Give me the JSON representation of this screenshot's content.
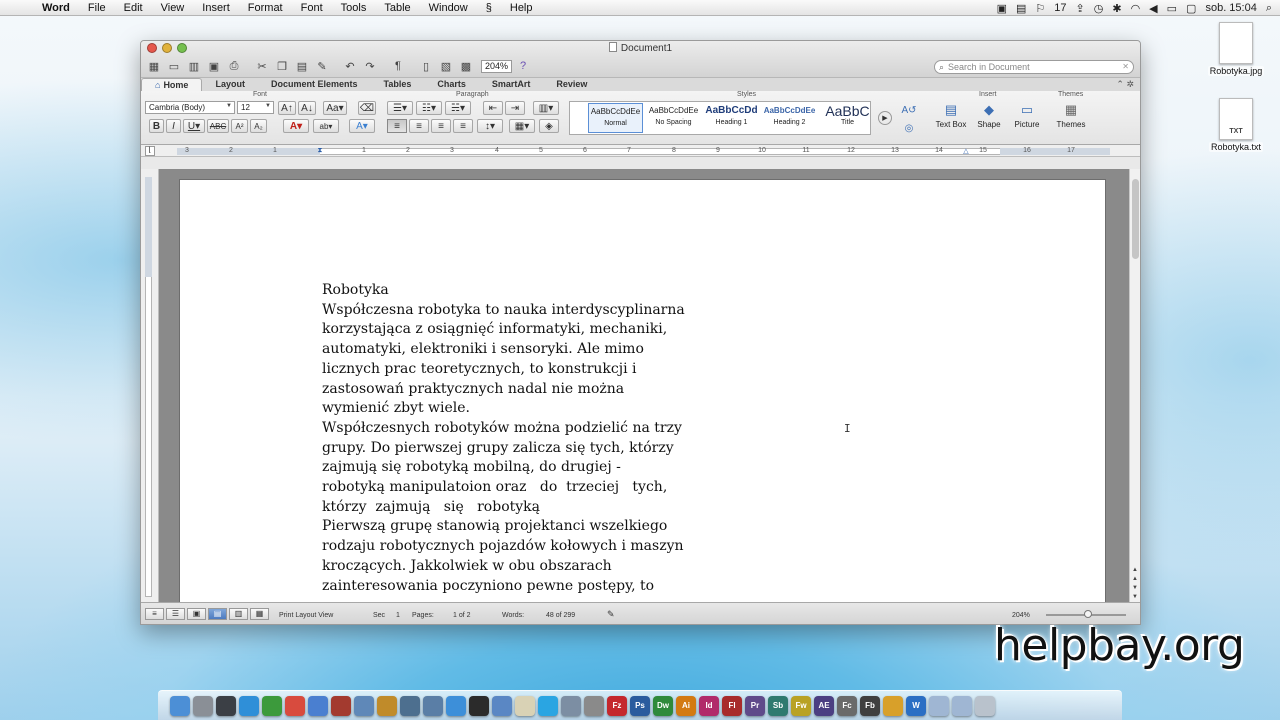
{
  "menubar": {
    "app": "Word",
    "items": [
      "File",
      "Edit",
      "View",
      "Insert",
      "Format",
      "Font",
      "Tools",
      "Table",
      "Window",
      "Help"
    ],
    "status_17": "17",
    "clock": "sob. 15:04"
  },
  "desktop_icons": [
    {
      "label": "Robotyka.jpg",
      "badge": ""
    },
    {
      "label": "Robotyka.txt",
      "badge": "TXT"
    }
  ],
  "window": {
    "title": "Document1",
    "zoom": "204%",
    "search_placeholder": "Search in Document"
  },
  "tabs": [
    "Home",
    "Layout",
    "Document Elements",
    "Tables",
    "Charts",
    "SmartArt",
    "Review"
  ],
  "ribbon": {
    "groups": {
      "font": "Font",
      "paragraph": "Paragraph",
      "styles": "Styles",
      "insert": "Insert",
      "themes": "Themes"
    },
    "font_name": "Cambria (Body)",
    "font_size": "12",
    "styles": [
      {
        "preview": "AaBbCcDdEe",
        "name": "Normal"
      },
      {
        "preview": "AaBbCcDdEe",
        "name": "No Spacing"
      },
      {
        "preview": "AaBbCcDd",
        "name": "Heading 1"
      },
      {
        "preview": "AaBbCcDdEe",
        "name": "Heading 2"
      },
      {
        "preview": "AaBbC",
        "name": "Title"
      }
    ],
    "insert_buttons": [
      "Text Box",
      "Shape",
      "Picture"
    ],
    "themes_button": "Themes"
  },
  "ruler_numbers": [
    "3",
    "2",
    "1",
    "1",
    "2",
    "3",
    "4",
    "5",
    "6",
    "7",
    "8",
    "9",
    "10",
    "11",
    "12",
    "13",
    "14",
    "15",
    "16",
    "17"
  ],
  "document": {
    "lines": [
      "Robotyka",
      "Współczesna robotyka to nauka interdyscyplinarna",
      "korzystająca z osiągnięć informatyki, mechaniki,",
      "automatyki, elektroniki i sensoryki. Ale mimo",
      "licznych prac teoretycznych, to konstrukcji i",
      "zastosowań praktycznych nadal nie można",
      "wymienić zbyt wiele.",
      "Współczesnych robotyków można podzielić na trzy",
      "grupy. Do pierwszej grupy zalicza się tych, którzy",
      "zajmują się robotyką mobilną, do drugiej -",
      "robotyką manipulatoion oraz   do  trzeciej   tych,",
      "którzy  zajmują   się   robotyką",
      "Pierwszą grupę stanowią projektanci wszelkiego",
      "rodzaju robotycznych pojazdów kołowych i maszyn",
      "kroczących. Jakkolwiek w obu obszarach",
      "zainteresowania poczyniono pewne postępy, to"
    ]
  },
  "statusbar": {
    "view": "Print Layout View",
    "sec_label": "Sec",
    "sec_value": "1",
    "pages_label": "Pages:",
    "pages_value": "1 of 2",
    "words_label": "Words:",
    "words_value": "48 of 299",
    "zoom": "204%"
  },
  "watermark": "helpbay.org",
  "dock_apps": [
    {
      "name": "finder",
      "label": "",
      "color": "#4c8fd6"
    },
    {
      "name": "launchpad",
      "label": "",
      "color": "#8a8f96"
    },
    {
      "name": "mission-control",
      "label": "",
      "color": "#3b3f45"
    },
    {
      "name": "safari",
      "label": "",
      "color": "#2f8fd8"
    },
    {
      "name": "chrome",
      "label": "",
      "color": "#3c9a3c"
    },
    {
      "name": "calendar",
      "label": "",
      "color": "#d84b3e"
    },
    {
      "name": "itunes",
      "label": "",
      "color": "#4a7fd0"
    },
    {
      "name": "photo-booth",
      "label": "",
      "color": "#a33a2f"
    },
    {
      "name": "iphoto",
      "label": "",
      "color": "#5f88b8"
    },
    {
      "name": "garageband",
      "label": "",
      "color": "#c08b2a"
    },
    {
      "name": "time-machine",
      "label": "",
      "color": "#4d6f8f"
    },
    {
      "name": "xcode",
      "label": "",
      "color": "#5a7ea6"
    },
    {
      "name": "app-store",
      "label": "",
      "color": "#3d8fd9"
    },
    {
      "name": "terminal",
      "label": "",
      "color": "#2b2b2b"
    },
    {
      "name": "preview",
      "label": "",
      "color": "#5a87c4"
    },
    {
      "name": "textedit",
      "label": "",
      "color": "#d9d2b5"
    },
    {
      "name": "skype",
      "label": "",
      "color": "#2aa5e2"
    },
    {
      "name": "utilities",
      "label": "",
      "color": "#7c8ea3"
    },
    {
      "name": "system-preferences",
      "label": "",
      "color": "#8a8a8a"
    },
    {
      "name": "filezilla",
      "label": "Fz",
      "color": "#c4282d"
    },
    {
      "name": "photoshop",
      "label": "Ps",
      "color": "#2a5c9e"
    },
    {
      "name": "dreamweaver",
      "label": "Dw",
      "color": "#2f8a3b"
    },
    {
      "name": "illustrator",
      "label": "Ai",
      "color": "#d37a12"
    },
    {
      "name": "indesign",
      "label": "Id",
      "color": "#b12a6a"
    },
    {
      "name": "flash",
      "label": "Fl",
      "color": "#a82b2b"
    },
    {
      "name": "premiere",
      "label": "Pr",
      "color": "#5f4a8a"
    },
    {
      "name": "soundbooth",
      "label": "Sb",
      "color": "#2f7a6f"
    },
    {
      "name": "fireworks",
      "label": "Fw",
      "color": "#b9a224"
    },
    {
      "name": "after-effects",
      "label": "AE",
      "color": "#4b3f82"
    },
    {
      "name": "flash-catalyst",
      "label": "Fc",
      "color": "#6a6a6a"
    },
    {
      "name": "flash-builder",
      "label": "Fb",
      "color": "#3f3f3f"
    },
    {
      "name": "picasa",
      "label": "",
      "color": "#d8a02a"
    },
    {
      "name": "word",
      "label": "W",
      "color": "#2a6fc4"
    },
    {
      "name": "documents-folder",
      "label": "",
      "color": "#9fb6d3"
    },
    {
      "name": "downloads-folder",
      "label": "",
      "color": "#9fb6d3"
    },
    {
      "name": "trash",
      "label": "",
      "color": "#b9c2cc"
    }
  ]
}
